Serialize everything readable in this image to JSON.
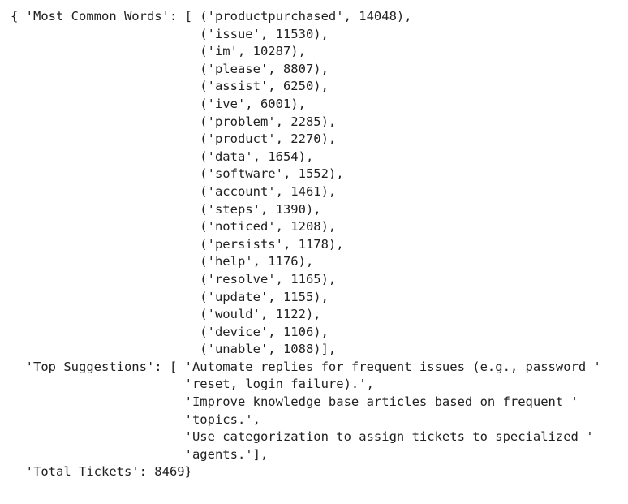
{
  "output_lines": [
    "{ 'Most Common Words': [ ('productpurchased', 14048),",
    "                         ('issue', 11530),",
    "                         ('im', 10287),",
    "                         ('please', 8807),",
    "                         ('assist', 6250),",
    "                         ('ive', 6001),",
    "                         ('problem', 2285),",
    "                         ('product', 2270),",
    "                         ('data', 1654),",
    "                         ('software', 1552),",
    "                         ('account', 1461),",
    "                         ('steps', 1390),",
    "                         ('noticed', 1208),",
    "                         ('persists', 1178),",
    "                         ('help', 1176),",
    "                         ('resolve', 1165),",
    "                         ('update', 1155),",
    "                         ('would', 1122),",
    "                         ('device', 1106),",
    "                         ('unable', 1088)],",
    "  'Top Suggestions': [ 'Automate replies for frequent issues (e.g., password '",
    "                       'reset, login failure).',",
    "                       'Improve knowledge base articles based on frequent '",
    "                       'topics.',",
    "                       'Use categorization to assign tickets to specialized '",
    "                       'agents.'],",
    "  'Total Tickets': 8469}"
  ]
}
